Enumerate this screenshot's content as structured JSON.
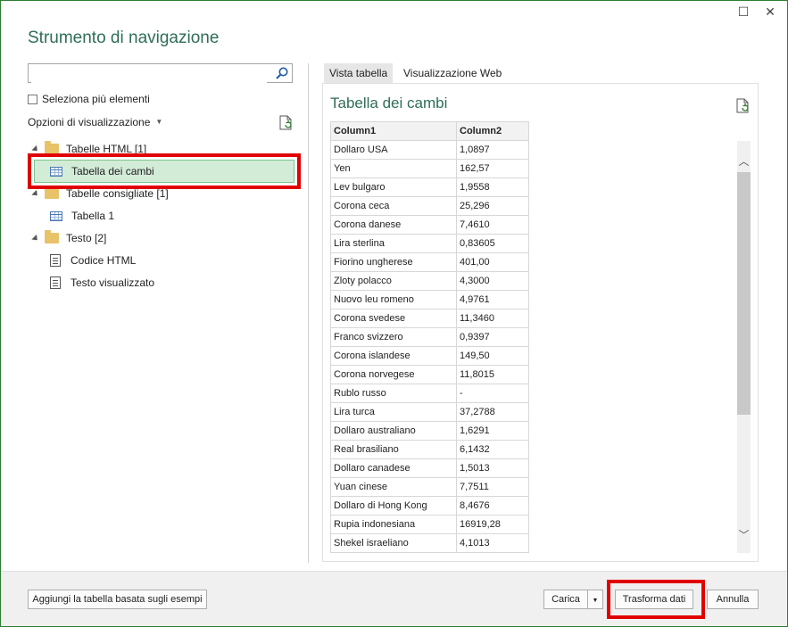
{
  "window": {
    "title": "Strumento di navigazione",
    "maximize_glyph": "☐",
    "close_glyph": "✕"
  },
  "left": {
    "search": {
      "value": "",
      "placeholder": ""
    },
    "multi_select_label": "Seleziona più elementi",
    "view_options_label": "Opzioni di visualizzazione",
    "tree": [
      {
        "type": "folder",
        "label": "Tabelle HTML [1]"
      },
      {
        "type": "table",
        "label": "Tabella dei cambi",
        "selected": true
      },
      {
        "type": "folder",
        "label": "Tabelle consigliate [1]"
      },
      {
        "type": "table",
        "label": "Tabella 1"
      },
      {
        "type": "folder",
        "label": "Testo [2]"
      },
      {
        "type": "document",
        "label": "Codice HTML"
      },
      {
        "type": "document",
        "label": "Testo visualizzato"
      }
    ]
  },
  "right": {
    "tabs": [
      {
        "label": "Vista tabella",
        "active": true
      },
      {
        "label": "Visualizzazione Web",
        "active": false
      }
    ],
    "preview_title": "Tabella dei cambi",
    "columns": [
      "Column1",
      "Column2"
    ],
    "rows": [
      [
        "Dollaro USA",
        "1,0897"
      ],
      [
        "Yen",
        "162,57"
      ],
      [
        "Lev bulgaro",
        "1,9558"
      ],
      [
        "Corona ceca",
        "25,296"
      ],
      [
        "Corona danese",
        "7,4610"
      ],
      [
        "Lira sterlina",
        "0,83605"
      ],
      [
        "Fiorino ungherese",
        "401,00"
      ],
      [
        "Zloty polacco",
        "4,3000"
      ],
      [
        "Nuovo leu romeno",
        "4,9761"
      ],
      [
        "Corona svedese",
        "11,3460"
      ],
      [
        "Franco svizzero",
        "0,9397"
      ],
      [
        "Corona islandese",
        "149,50"
      ],
      [
        "Corona norvegese",
        "11,8015"
      ],
      [
        "Rublo russo",
        "-"
      ],
      [
        "Lira turca",
        "37,2788"
      ],
      [
        "Dollaro australiano",
        "1,6291"
      ],
      [
        "Real brasiliano",
        "6,1432"
      ],
      [
        "Dollaro canadese",
        "1,5013"
      ],
      [
        "Yuan cinese",
        "7,7511"
      ],
      [
        "Dollaro di Hong Kong",
        "8,4676"
      ],
      [
        "Rupia indonesiana",
        "16919,28"
      ],
      [
        "Shekel israeliano",
        "4,1013"
      ]
    ]
  },
  "footer": {
    "add_table_label": "Aggiungi la tabella basata sugli esempi",
    "load_label": "Carica",
    "transform_label": "Trasforma dati",
    "cancel_label": "Annulla"
  },
  "colors": {
    "accent": "#2e6e55",
    "selection": "#d3ecd8",
    "highlight": "#e00000"
  },
  "icons": [
    "search-icon",
    "refresh-icon",
    "folder-icon",
    "table-icon",
    "document-icon",
    "dropdown-caret-icon",
    "scroll-up-icon",
    "scroll-down-icon"
  ]
}
